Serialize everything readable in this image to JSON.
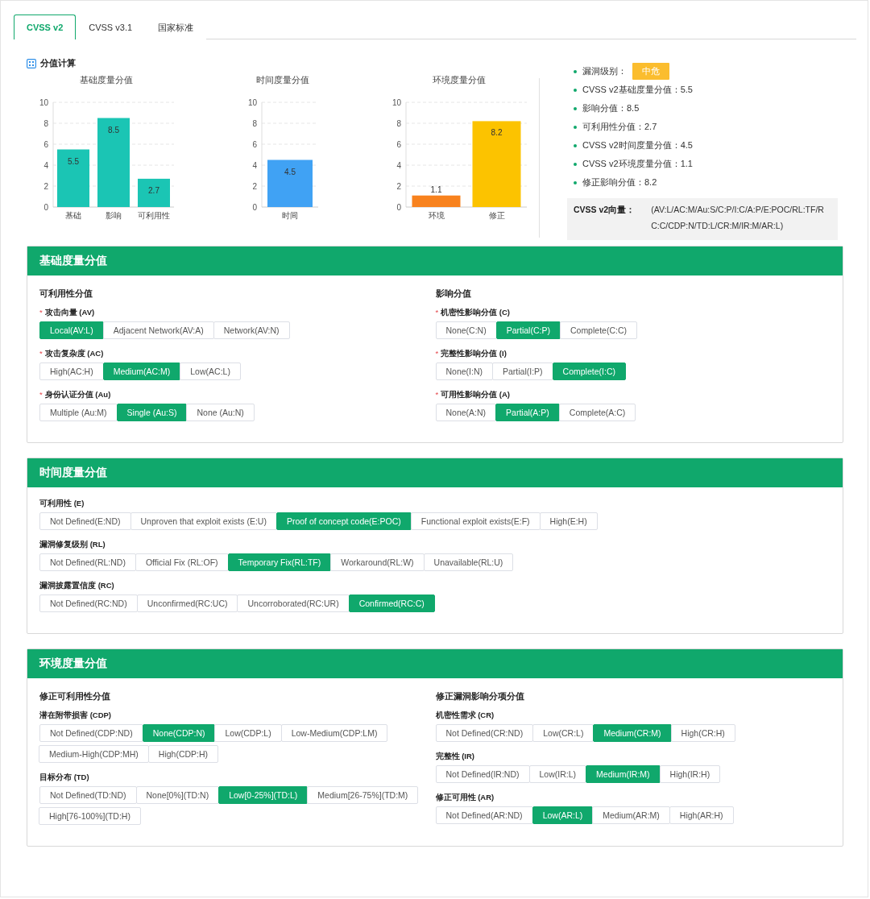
{
  "tabs": [
    {
      "label": "CVSS v2",
      "selected": true
    },
    {
      "label": "CVSS v3.1",
      "selected": false
    },
    {
      "label": "国家标准",
      "selected": false
    }
  ],
  "score": {
    "title": "分值计算",
    "charts": [
      {
        "chart_data": {
          "type": "bar",
          "title": "基础度量分值",
          "categories": [
            "基础",
            "影响",
            "可利用性"
          ],
          "series": [
            {
              "color": "#1bc5b4",
              "values": [
                5.5,
                8.5,
                2.7
              ]
            }
          ],
          "ylim": [
            0,
            10
          ],
          "yticks": [
            0,
            2,
            4,
            6,
            8,
            10
          ],
          "grid": true,
          "data_labels": true
        }
      },
      {
        "chart_data": {
          "type": "bar",
          "title": "时间度量分值",
          "categories": [
            "时间"
          ],
          "series": [
            {
              "color": "#40a2f4",
              "values": [
                4.5
              ]
            }
          ],
          "ylim": [
            0,
            10
          ],
          "yticks": [
            0,
            2,
            4,
            6,
            8,
            10
          ],
          "grid": true,
          "data_labels": true
        }
      },
      {
        "chart_data": {
          "type": "bar",
          "title": "环境度量分值",
          "categories": [
            "环境",
            "修正"
          ],
          "series": [
            {
              "color": "#f8821e",
              "values": [
                1.1,
                null
              ]
            },
            {
              "color": "#fcc300",
              "values": [
                null,
                8.2
              ]
            }
          ],
          "stacked": true,
          "ylim": [
            0,
            10
          ],
          "yticks": [
            0,
            2,
            4,
            6,
            8,
            10
          ],
          "grid": true,
          "data_labels": true
        }
      }
    ],
    "summary": [
      {
        "kind": "badge",
        "label": "漏洞级别：",
        "value": "中危"
      },
      {
        "kind": "text",
        "label": "CVSS v2基础度量分值：",
        "value": "5.5"
      },
      {
        "kind": "text",
        "label": "影响分值：",
        "value": "8.5"
      },
      {
        "kind": "text",
        "label": "可利用性分值：",
        "value": "2.7"
      },
      {
        "kind": "text",
        "label": "CVSS v2时间度量分值：",
        "value": "4.5"
      },
      {
        "kind": "text",
        "label": "CVSS v2环境度量分值：",
        "value": "1.1"
      },
      {
        "kind": "text",
        "label": "修正影响分值：",
        "value": "8.2"
      }
    ],
    "vector": {
      "label": "CVSS v2向量：",
      "value": "(AV:L/AC:M/Au:S/C:P/I:C/A:P/E:POC/RL:TF/RC:C/CDP:N/TD:L/CR:M/IR:M/AR:L)"
    }
  },
  "sections": [
    {
      "title": "基础度量分值",
      "columns": [
        {
          "title": "可利用性分值",
          "groups": [
            {
              "label": "攻击向量 (AV)",
              "marker": "*",
              "options": [
                {
                  "label": "Local(AV:L)",
                  "selected": true
                },
                {
                  "label": "Adjacent Network(AV:A)",
                  "selected": false
                },
                {
                  "label": "Network(AV:N)",
                  "selected": false
                }
              ]
            },
            {
              "label": "攻击复杂度 (AC)",
              "marker": "*",
              "options": [
                {
                  "label": "High(AC:H)",
                  "selected": false
                },
                {
                  "label": "Medium(AC:M)",
                  "selected": true
                },
                {
                  "label": "Low(AC:L)",
                  "selected": false
                }
              ]
            },
            {
              "label": "身份认证分值 (Au)",
              "marker": "*",
              "options": [
                {
                  "label": "Multiple (Au:M)",
                  "selected": false
                },
                {
                  "label": "Single (Au:S)",
                  "selected": true
                },
                {
                  "label": "None (Au:N)",
                  "selected": false
                }
              ]
            }
          ]
        },
        {
          "title": "影响分值",
          "groups": [
            {
              "label": "机密性影响分值 (C)",
              "marker": "*",
              "options": [
                {
                  "label": "None(C:N)",
                  "selected": false
                },
                {
                  "label": "Partial(C:P)",
                  "selected": true
                },
                {
                  "label": "Complete(C:C)",
                  "selected": false
                }
              ]
            },
            {
              "label": "完整性影响分值 (I)",
              "marker": "*",
              "options": [
                {
                  "label": "None(I:N)",
                  "selected": false
                },
                {
                  "label": "Partial(I:P)",
                  "selected": false
                },
                {
                  "label": "Complete(I:C)",
                  "selected": true
                }
              ]
            },
            {
              "label": "可用性影响分值 (A)",
              "marker": "*",
              "options": [
                {
                  "label": "None(A:N)",
                  "selected": false
                },
                {
                  "label": "Partial(A:P)",
                  "selected": true
                },
                {
                  "label": "Complete(A:C)",
                  "selected": false
                }
              ]
            }
          ]
        }
      ]
    },
    {
      "title": "时间度量分值",
      "columns": [
        {
          "groups": [
            {
              "label": "可利用性 (E)",
              "options": [
                {
                  "label": "Not Defined(E:ND)",
                  "selected": false
                },
                {
                  "label": "Unproven that exploit exists (E:U)",
                  "selected": false
                },
                {
                  "label": "Proof of concept code(E:POC)",
                  "selected": true
                },
                {
                  "label": "Functional exploit exists(E:F)",
                  "selected": false
                },
                {
                  "label": "High(E:H)",
                  "selected": false
                }
              ]
            },
            {
              "label": "漏洞修复级别 (RL)",
              "options": [
                {
                  "label": "Not Defined(RL:ND)",
                  "selected": false
                },
                {
                  "label": "Official Fix (RL:OF)",
                  "selected": false
                },
                {
                  "label": "Temporary Fix(RL:TF)",
                  "selected": true
                },
                {
                  "label": "Workaround(RL:W)",
                  "selected": false
                },
                {
                  "label": "Unavailable(RL:U)",
                  "selected": false
                }
              ]
            },
            {
              "label": "漏洞披露置信度 (RC)",
              "options": [
                {
                  "label": "Not Defined(RC:ND)",
                  "selected": false
                },
                {
                  "label": "Unconfirmed(RC:UC)",
                  "selected": false
                },
                {
                  "label": "Uncorroborated(RC:UR)",
                  "selected": false
                },
                {
                  "label": "Confirmed(RC:C)",
                  "selected": true
                }
              ]
            }
          ]
        }
      ]
    },
    {
      "title": "环境度量分值",
      "columns": [
        {
          "title": "修正可利用性分值",
          "groups": [
            {
              "label": "潜在附带损害 (CDP)",
              "options": [
                {
                  "label": "Not Defined(CDP:ND)",
                  "selected": false
                },
                {
                  "label": "None(CDP:N)",
                  "selected": true
                },
                {
                  "label": "Low(CDP:L)",
                  "selected": false
                },
                {
                  "label": "Low-Medium(CDP:LM)",
                  "selected": false
                },
                {
                  "label": "Medium-High(CDP:MH)",
                  "selected": false
                },
                {
                  "label": "High(CDP:H)",
                  "selected": false
                }
              ]
            },
            {
              "label": "目标分布 (TD)",
              "options": [
                {
                  "label": "Not Defined(TD:ND)",
                  "selected": false
                },
                {
                  "label": "None[0%](TD:N)",
                  "selected": false
                },
                {
                  "label": "Low[0-25%](TD:L)",
                  "selected": true
                },
                {
                  "label": "Medium[26-75%](TD:M)",
                  "selected": false
                },
                {
                  "label": "High[76-100%](TD:H)",
                  "selected": false
                }
              ]
            }
          ]
        },
        {
          "title": "修正漏洞影响分项分值",
          "groups": [
            {
              "label": "机密性需求 (CR)",
              "options": [
                {
                  "label": "Not Defined(CR:ND)",
                  "selected": false
                },
                {
                  "label": "Low(CR:L)",
                  "selected": false
                },
                {
                  "label": "Medium(CR:M)",
                  "selected": true
                },
                {
                  "label": "High(CR:H)",
                  "selected": false
                }
              ]
            },
            {
              "label": "完整性 (IR)",
              "options": [
                {
                  "label": "Not Defined(IR:ND)",
                  "selected": false
                },
                {
                  "label": "Low(IR:L)",
                  "selected": false
                },
                {
                  "label": "Medium(IR:M)",
                  "selected": true
                },
                {
                  "label": "High(IR:H)",
                  "selected": false
                }
              ]
            },
            {
              "label": "修正可用性 (AR)",
              "options": [
                {
                  "label": "Not Defined(AR:ND)",
                  "selected": false
                },
                {
                  "label": "Low(AR:L)",
                  "selected": true
                },
                {
                  "label": "Medium(AR:M)",
                  "selected": false
                },
                {
                  "label": "High(AR:H)",
                  "selected": false
                }
              ]
            }
          ]
        }
      ]
    }
  ]
}
